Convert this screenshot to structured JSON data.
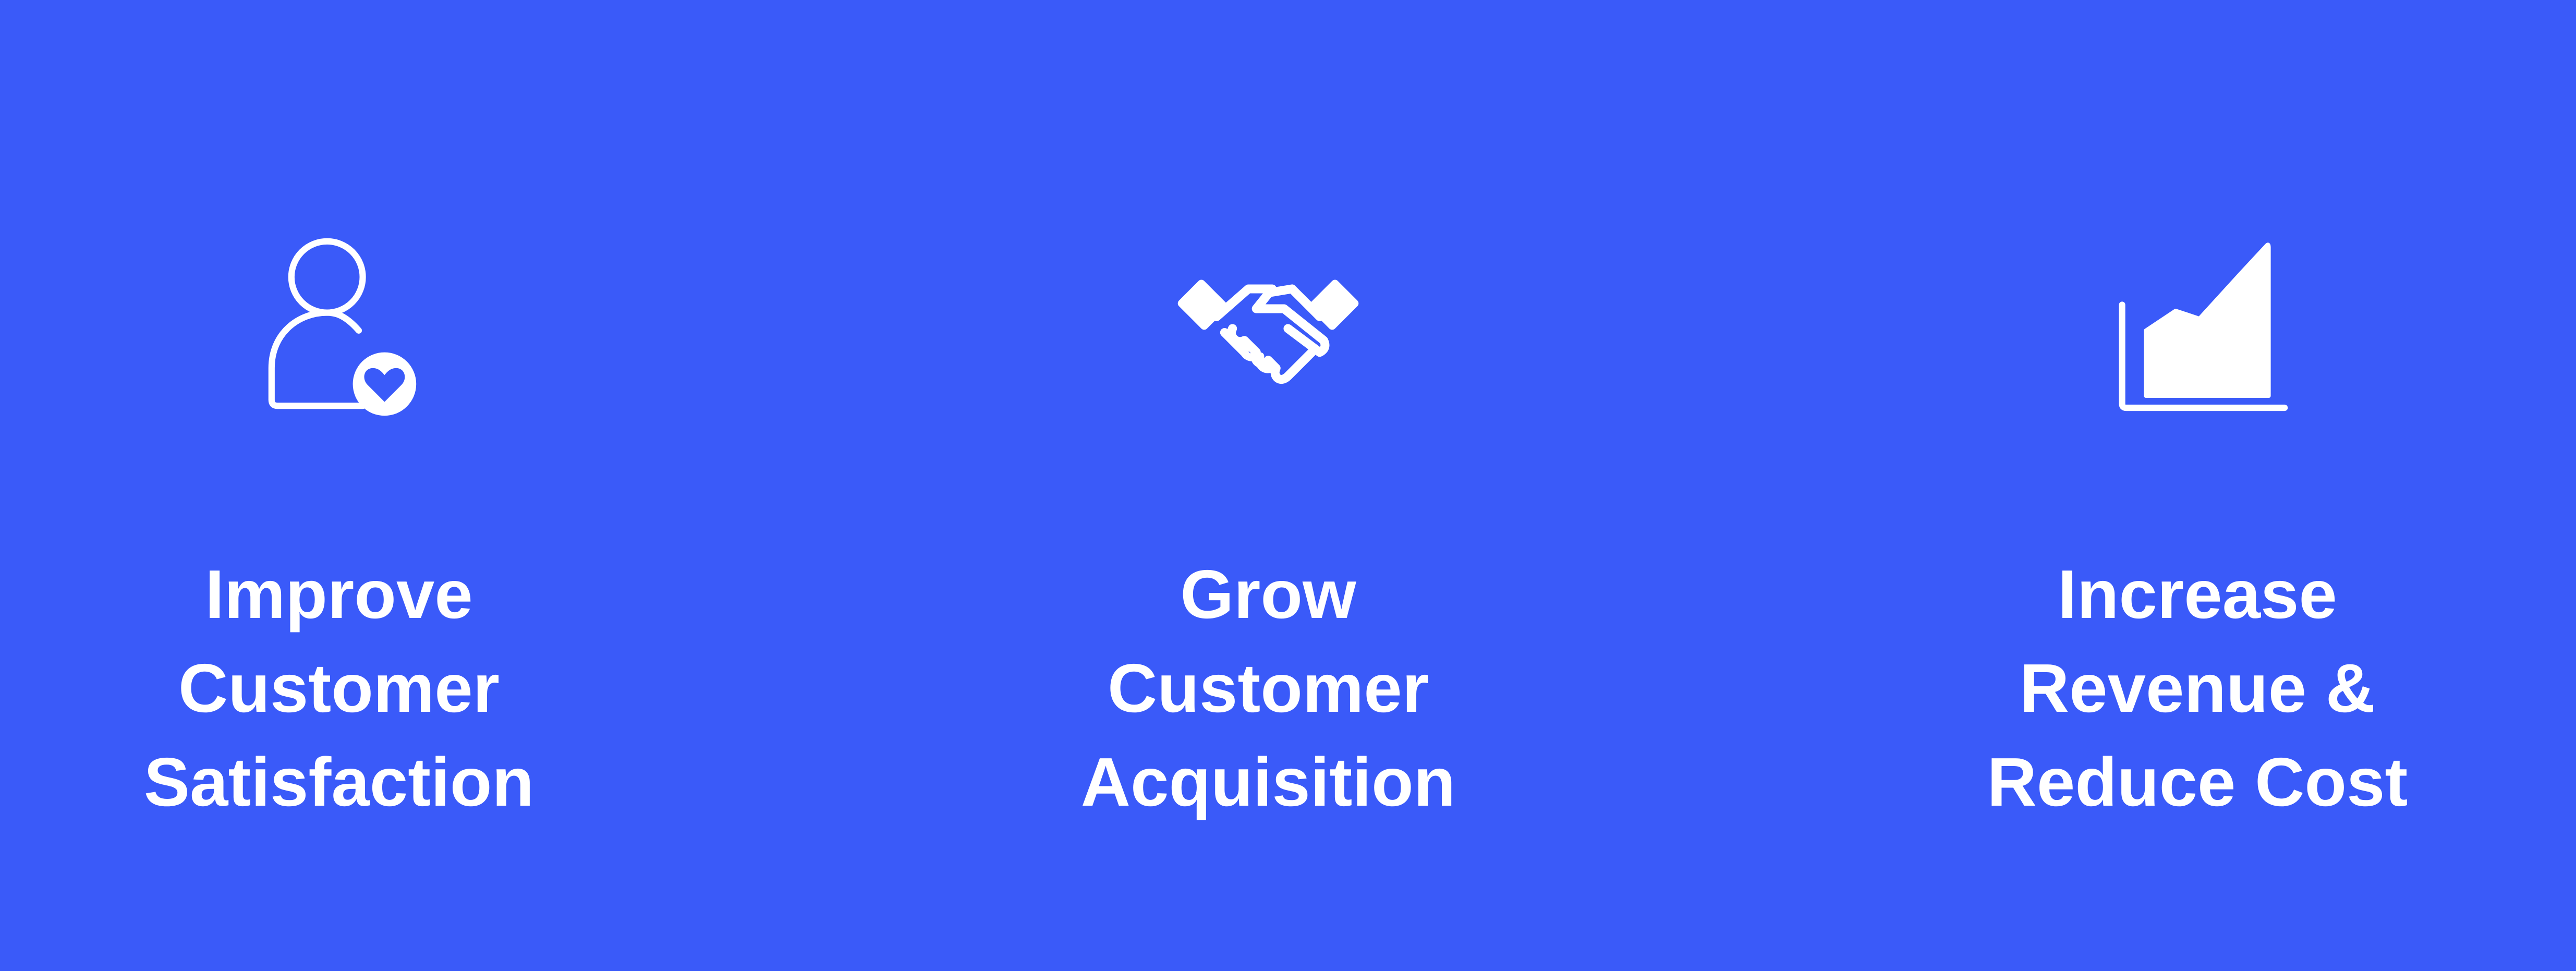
{
  "colors": {
    "background": "#3a5af9",
    "foreground": "#ffffff"
  },
  "features": [
    {
      "icon": "user-heart-icon",
      "label_lines": [
        "Improve",
        "Customer",
        "Satisfaction"
      ]
    },
    {
      "icon": "handshake-icon",
      "label_lines": [
        "Grow",
        "Customer",
        "Acquisition"
      ]
    },
    {
      "icon": "area-chart-icon",
      "label_lines": [
        "Increase",
        "Revenue &",
        "Reduce Cost"
      ]
    }
  ]
}
